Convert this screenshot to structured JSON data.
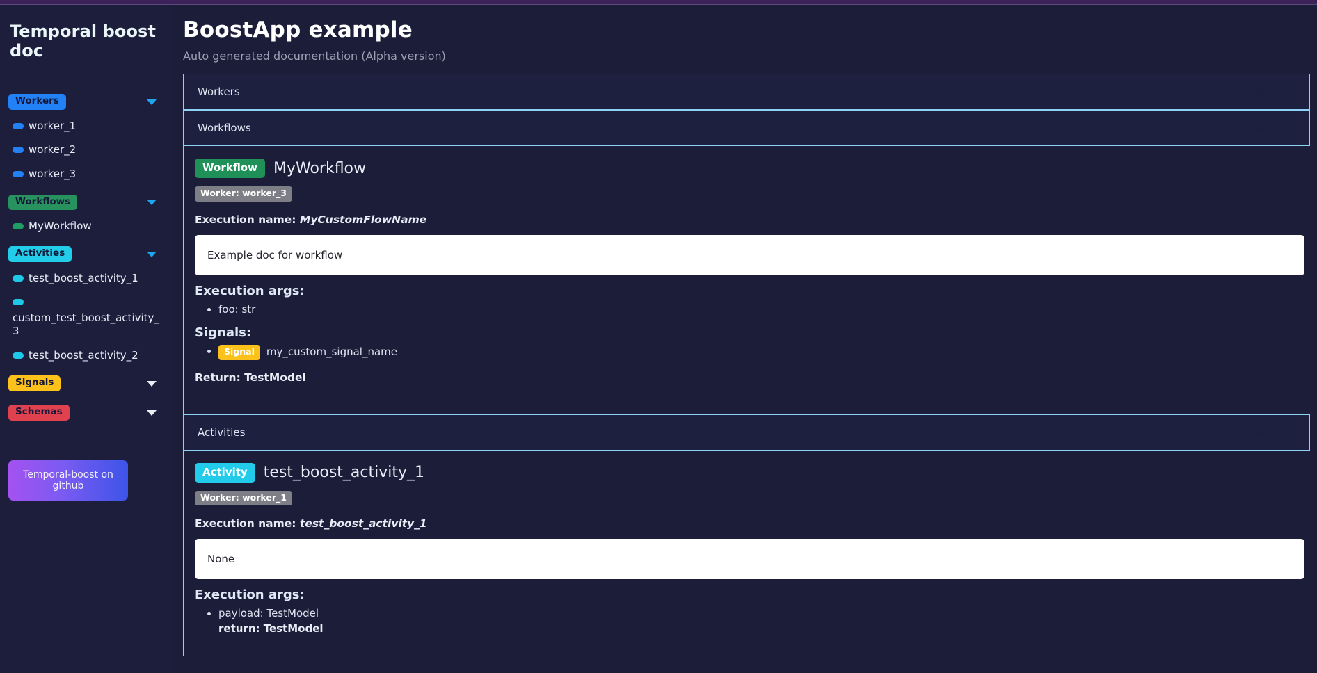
{
  "sidebar": {
    "title": "Temporal boost doc",
    "groups": [
      {
        "label": "Workers",
        "pill_color": "#2281f5",
        "items": [
          {
            "label": "worker_1"
          },
          {
            "label": "worker_2"
          },
          {
            "label": "worker_3"
          }
        ]
      },
      {
        "label": "Workflows",
        "pill_color": "#27925e",
        "items": [
          {
            "label": "MyWorkflow"
          }
        ]
      },
      {
        "label": "Activities",
        "pill_color": "#21cde8",
        "items": [
          {
            "label": "test_boost_activity_1"
          },
          {
            "label": "custom_test_boost_activity_3"
          },
          {
            "label": "test_boost_activity_2"
          }
        ]
      },
      {
        "label": "Signals",
        "pill_color": "#fcc11a",
        "items": []
      },
      {
        "label": "Schemas",
        "pill_color": "#e0414f",
        "items": []
      }
    ],
    "github_button": "Temporal-boost on github"
  },
  "main": {
    "title": "BoostApp example",
    "subtitle": "Auto generated documentation (Alpha version)",
    "sections": [
      {
        "label": "Workers"
      },
      {
        "label": "Workflows"
      },
      {
        "label": "Activities"
      }
    ],
    "workflow": {
      "badge": "Workflow",
      "name": "MyWorkflow",
      "worker_tag": "Worker: worker_3",
      "exec_name_label": "Execution name:",
      "exec_name_value": "MyCustomFlowName",
      "doc": "Example doc for workflow",
      "args_heading": "Execution args:",
      "args": [
        "foo: str"
      ],
      "signals_heading": "Signals:",
      "signal_badge": "Signal",
      "signal_name": "my_custom_signal_name",
      "return_label": "Return: TestModel"
    },
    "activity": {
      "badge": "Activity",
      "name": "test_boost_activity_1",
      "worker_tag": "Worker: worker_1",
      "exec_name_label": "Execution name:",
      "exec_name_value": "test_boost_activity_1",
      "doc": "None",
      "args_heading": "Execution args:",
      "arg_payload": "payload: TestModel",
      "arg_return": "return: TestModel"
    }
  },
  "colors": {
    "page_bg": "#1c1d38",
    "sidebar_bg": "#1d1e3c",
    "accent_border": "#8ed1f7",
    "top_bar": "#3b2359",
    "workflow_green": "#1f9057",
    "activity_cyan": "#22cbe9",
    "signal_yellow": "#fcc11a"
  }
}
